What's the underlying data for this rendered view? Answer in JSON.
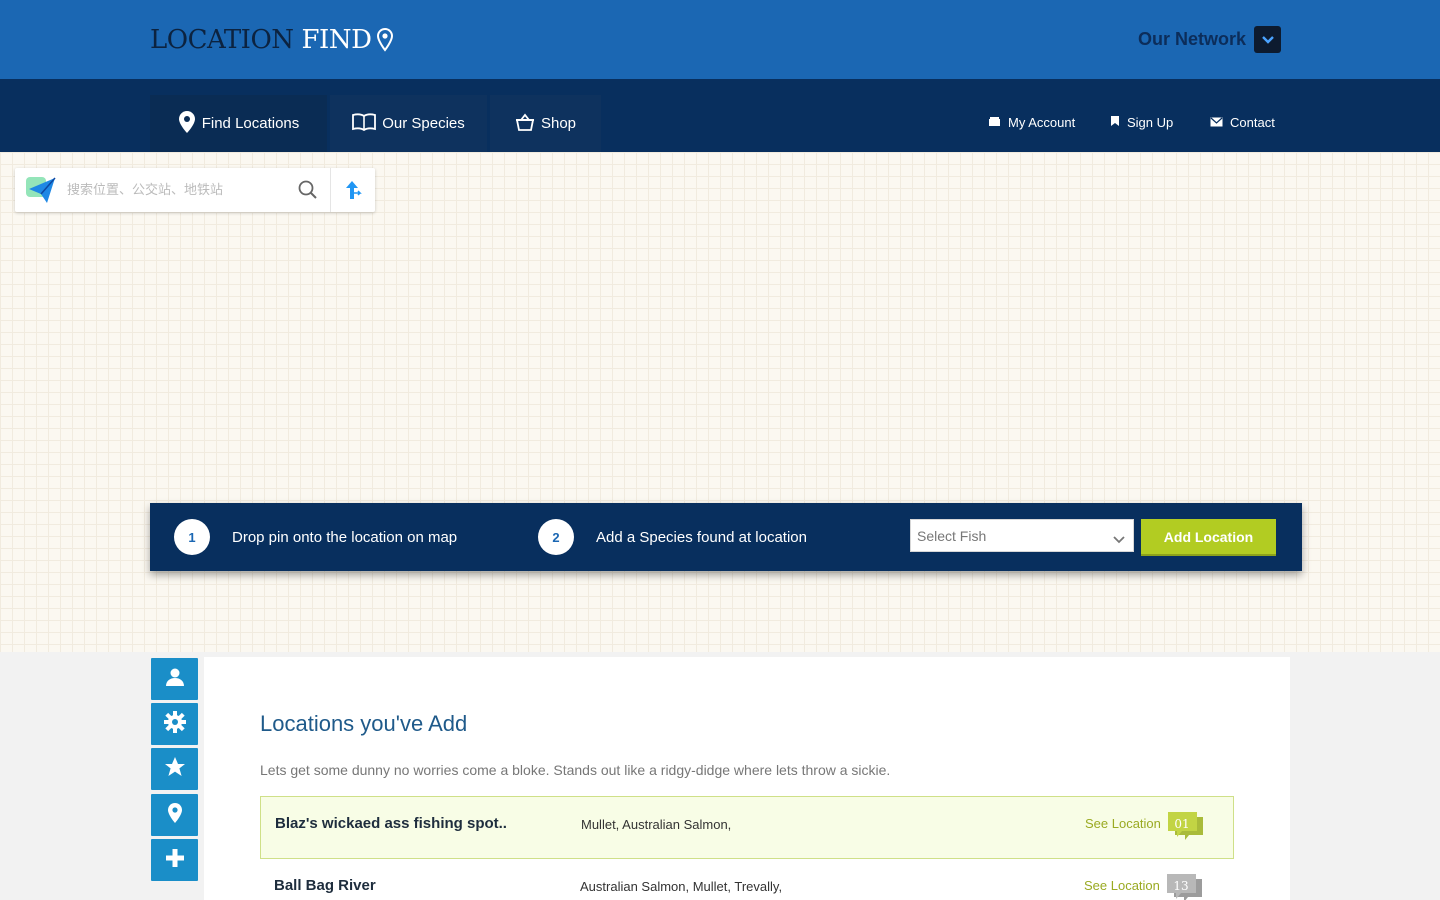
{
  "header": {
    "logo_word1": "LOCATION",
    "logo_word2": "FIND",
    "network_label": "Our Network"
  },
  "nav": {
    "tabs": [
      {
        "label": "Find Locations",
        "icon": "map-pin-icon"
      },
      {
        "label": "Our Species",
        "icon": "book-icon"
      },
      {
        "label": "Shop",
        "icon": "basket-icon"
      }
    ],
    "links": [
      {
        "label": "My Account",
        "icon": "wallet-icon"
      },
      {
        "label": "Sign Up",
        "icon": "bookmark-icon"
      },
      {
        "label": "Contact",
        "icon": "envelope-icon"
      }
    ]
  },
  "map_search": {
    "placeholder": "搜索位置、公交站、地铁站"
  },
  "instructions": {
    "step1_number": "1",
    "step1_text": "Drop pin onto the location on map",
    "step2_number": "2",
    "step2_text": "Add a Species found at location",
    "select_value": "Select Fish",
    "add_button": "Add Location"
  },
  "sidebar_icons": [
    "user-icon",
    "gear-icon",
    "star-icon",
    "map-pin-icon",
    "plus-icon"
  ],
  "locations": {
    "title": "Locations you've Add",
    "description": "Lets get some dunny no worries come a bloke. Stands out like a ridgy-didge where lets throw a sickie.",
    "rows": [
      {
        "name": "Blaz's wickaed ass fishing spot..",
        "species": "Mullet, Australian Salmon,",
        "see": "See Location",
        "count": "01"
      },
      {
        "name": "Ball Bag River",
        "species": "Australian Salmon, Mullet, Trevally,",
        "see": "See Location",
        "count": "13"
      }
    ]
  },
  "colors": {
    "header_blue": "#1b67b3",
    "nav_navy": "#082f5e",
    "accent_green": "#b2cc22",
    "sidebar_blue": "#1a8ec8"
  }
}
